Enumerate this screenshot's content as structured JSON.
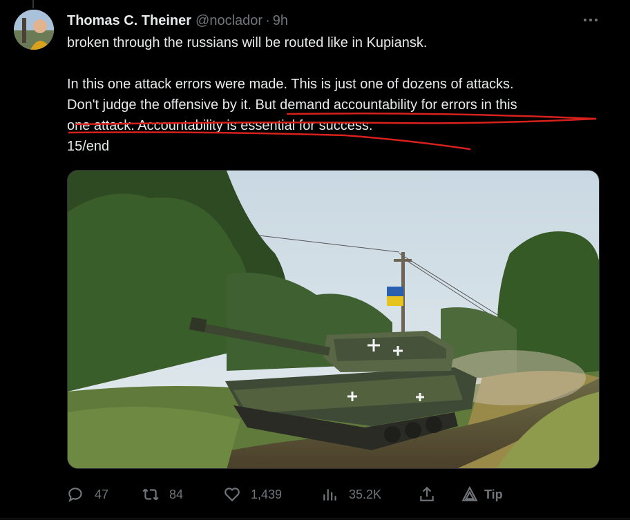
{
  "tweet": {
    "display_name": "Thomas C. Theiner",
    "handle": "@noclador",
    "separator": "·",
    "time": "9h",
    "lines": [
      "broken through the russians will be routed like in Kupiansk.",
      "",
      "In this one attack errors were made. This is just one of dozens of attacks.",
      "Don't judge the offensive by it. But demand accountability for errors in this",
      "one attack. Accountability is essential for success.",
      "15/end"
    ]
  },
  "actions": {
    "replies": "47",
    "retweets": "84",
    "likes": "1,439",
    "views": "35.2K",
    "tip_label": "Tip"
  },
  "icons": {
    "more": "more-horizontal-icon",
    "reply": "reply-icon",
    "retweet": "retweet-icon",
    "like": "heart-icon",
    "views": "views-icon",
    "share": "share-icon",
    "tip": "tip-icon"
  },
  "colors": {
    "background": "#000000",
    "text": "#e7e9ea",
    "secondary": "#71767b",
    "annotation": "#d8201c"
  }
}
